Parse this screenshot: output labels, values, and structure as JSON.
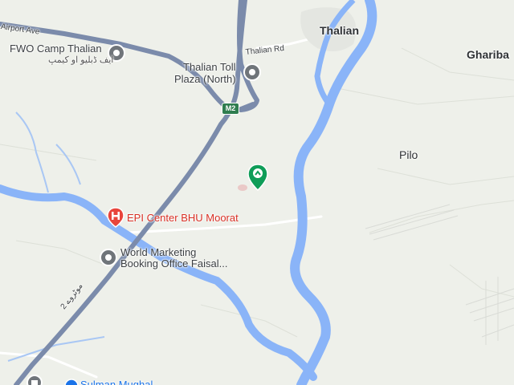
{
  "places": {
    "thalian": "Thalian",
    "ghariba": "Ghariba",
    "pilo": "Pilo"
  },
  "roads": {
    "airport_ave": "Airport Ave",
    "thalian_rd": "Thalian Rd",
    "m2_shield": "M2",
    "motorway_urdu": "موٹروے 2"
  },
  "pois": {
    "fwo_camp": {
      "name": "FWO Camp Thalian",
      "subtitle": "ایف ڈبلیو او کیمپ"
    },
    "toll_plaza": {
      "line1": "Thalian Toll",
      "line2": "Plaza (North)"
    },
    "epi_center": {
      "name": "EPI Center BHU Moorat"
    },
    "world_marketing": {
      "line1": "World Marketing",
      "line2": "Booking Office Faisal..."
    },
    "bottom_poi": {
      "name": "Sulman Mughal"
    }
  },
  "icons": {
    "generic_poi": "map-pin-icon",
    "hospital": "hospital-icon",
    "selected": "green-location-pin-icon",
    "mosque": "mosque-icon",
    "shop": "shop-icon"
  },
  "colors": {
    "background": "#eef0ea",
    "water": "#8ab4f8",
    "motorway": "#7b8bab",
    "road": "#ffffff",
    "poi_red": "#d93025",
    "selected_pin": "#0f9d58"
  }
}
